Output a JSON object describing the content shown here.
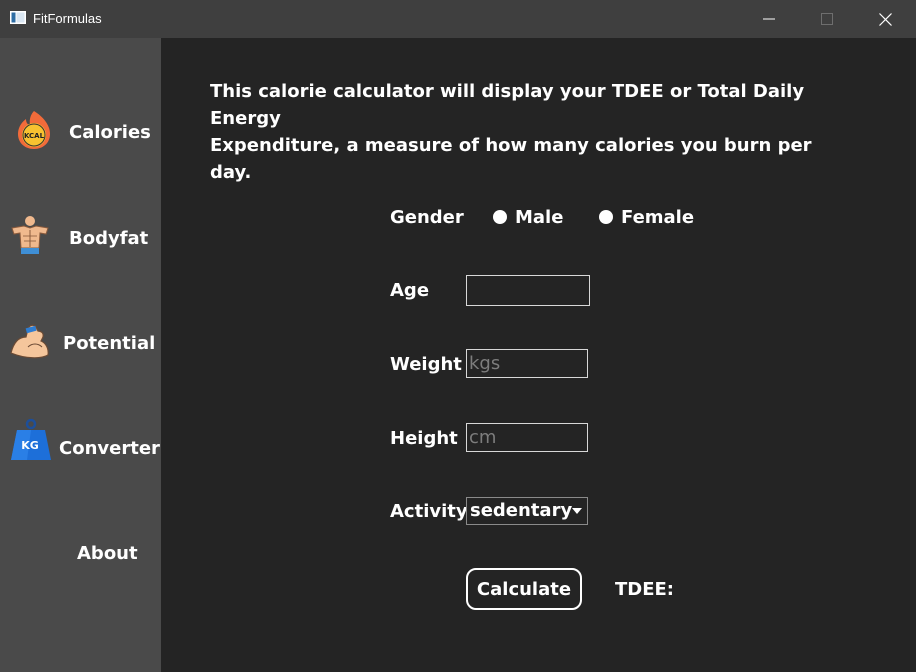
{
  "window": {
    "title": "FitFormulas"
  },
  "sidebar": {
    "items": [
      {
        "label": "Calories",
        "icon": "kcal-flame-icon"
      },
      {
        "label": "Bodyfat",
        "icon": "torso-icon"
      },
      {
        "label": "Potential",
        "icon": "flexed-arm-icon"
      },
      {
        "label": "Converter",
        "icon": "kg-weight-icon"
      },
      {
        "label": "About",
        "icon": ""
      }
    ]
  },
  "main": {
    "intro_line1": "This calorie calculator will display your TDEE or Total Daily Energy",
    "intro_line2": "Expenditure, a measure of how many calories you burn per day.",
    "gender_label": "Gender",
    "gender_options": [
      "Male",
      "Female"
    ],
    "age_label": "Age",
    "age_value": "",
    "weight_label": "Weight",
    "weight_placeholder": "kgs",
    "height_label": "Height",
    "height_placeholder": "cm",
    "activity_label": "Activity",
    "activity_selected": "sedentary",
    "calculate_label": "Calculate",
    "tdee_label": "TDEE:"
  },
  "colors": {
    "sidebar_bg": "#4a4a4a",
    "main_bg": "#242424",
    "titlebar_bg": "#3f3f3f",
    "text": "#ffffff",
    "placeholder": "#7d7d7d"
  }
}
